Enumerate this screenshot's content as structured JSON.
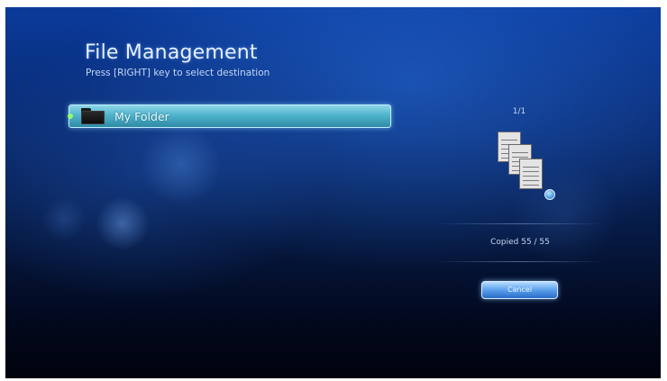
{
  "header": {
    "title": "File Management",
    "subtitle": "Press [RIGHT] key to select destination"
  },
  "folder_list": {
    "items": [
      {
        "label": "My Folder",
        "icon": "folder-icon",
        "selected": true
      }
    ]
  },
  "copy_panel": {
    "page_indicator": "1/1",
    "icon": "copy-files-icon",
    "status_text": "Copied 55 / 55",
    "cancel_label": "Cancel"
  },
  "colors": {
    "selection_highlight": "#4fb4cc",
    "button_accent": "#5aa0ec",
    "background_top": "#0a3a9a",
    "background_bottom": "#01040e"
  }
}
